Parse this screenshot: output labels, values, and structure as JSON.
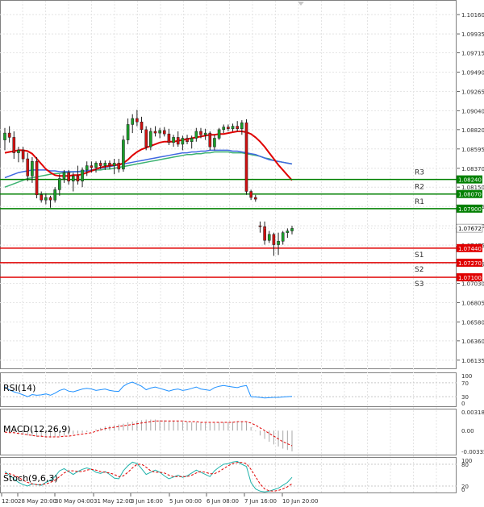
{
  "chart_data": {
    "type": "candlestick",
    "price": {
      "ylim": [
        1.0603,
        1.1033
      ],
      "y_ticks": [
        "1.10160",
        "1.09935",
        "1.09715",
        "1.09490",
        "1.09265",
        "1.09040",
        "1.08820",
        "1.08595",
        "1.08370",
        "1.08150",
        "1.07925",
        "1.07700",
        "1.07475",
        "1.07255",
        "1.07030",
        "1.06805",
        "1.06580",
        "1.06360",
        "1.06135"
      ],
      "levels": [
        {
          "name": "R3",
          "value": 1.0824,
          "label": "1.08240",
          "color": "#008000"
        },
        {
          "name": "R2",
          "value": 1.0807,
          "label": "1.08070",
          "color": "#008000"
        },
        {
          "name": "R1",
          "value": 1.079,
          "label": "1.07900",
          "color": "#008000"
        },
        {
          "name": "S1",
          "value": 1.0744,
          "label": "1.07440",
          "color": "#e00000"
        },
        {
          "name": "S2",
          "value": 1.0727,
          "label": "1.07270",
          "color": "#e00000"
        },
        {
          "name": "S3",
          "value": 1.071,
          "label": "1.07100",
          "color": "#e00000"
        }
      ],
      "current": {
        "value": 1.07672,
        "label": "1.07672"
      },
      "candles": [
        {
          "o": 1.087,
          "h": 1.0884,
          "l": 1.0858,
          "c": 1.0878
        },
        {
          "o": 1.0878,
          "h": 1.0886,
          "l": 1.0867,
          "c": 1.0873
        },
        {
          "o": 1.0873,
          "h": 1.088,
          "l": 1.0848,
          "c": 1.0855
        },
        {
          "o": 1.0855,
          "h": 1.0862,
          "l": 1.0844,
          "c": 1.0858
        },
        {
          "o": 1.0858,
          "h": 1.0862,
          "l": 1.0844,
          "c": 1.0848
        },
        {
          "o": 1.0848,
          "h": 1.0855,
          "l": 1.0822,
          "c": 1.0828
        },
        {
          "o": 1.0828,
          "h": 1.085,
          "l": 1.082,
          "c": 1.0845
        },
        {
          "o": 1.0845,
          "h": 1.085,
          "l": 1.0802,
          "c": 1.0806
        },
        {
          "o": 1.0806,
          "h": 1.081,
          "l": 1.0797,
          "c": 1.08
        },
        {
          "o": 1.08,
          "h": 1.0808,
          "l": 1.0795,
          "c": 1.0803
        },
        {
          "o": 1.0803,
          "h": 1.0805,
          "l": 1.0791,
          "c": 1.08
        },
        {
          "o": 1.08,
          "h": 1.0815,
          "l": 1.0797,
          "c": 1.0812
        },
        {
          "o": 1.0812,
          "h": 1.083,
          "l": 1.0805,
          "c": 1.0825
        },
        {
          "o": 1.0825,
          "h": 1.0835,
          "l": 1.082,
          "c": 1.0832
        },
        {
          "o": 1.0832,
          "h": 1.0835,
          "l": 1.0818,
          "c": 1.0822
        },
        {
          "o": 1.0822,
          "h": 1.0832,
          "l": 1.081,
          "c": 1.0828
        },
        {
          "o": 1.0828,
          "h": 1.084,
          "l": 1.0818,
          "c": 1.0822
        },
        {
          "o": 1.0822,
          "h": 1.0838,
          "l": 1.0815,
          "c": 1.0835
        },
        {
          "o": 1.0835,
          "h": 1.0845,
          "l": 1.0828,
          "c": 1.084
        },
        {
          "o": 1.084,
          "h": 1.0845,
          "l": 1.0832,
          "c": 1.0838
        },
        {
          "o": 1.0838,
          "h": 1.0845,
          "l": 1.0832,
          "c": 1.0843
        },
        {
          "o": 1.0843,
          "h": 1.0846,
          "l": 1.0836,
          "c": 1.084
        },
        {
          "o": 1.084,
          "h": 1.0846,
          "l": 1.0835,
          "c": 1.0843
        },
        {
          "o": 1.0843,
          "h": 1.0846,
          "l": 1.0836,
          "c": 1.084
        },
        {
          "o": 1.084,
          "h": 1.0848,
          "l": 1.083,
          "c": 1.0843
        },
        {
          "o": 1.0843,
          "h": 1.0848,
          "l": 1.0832,
          "c": 1.0836
        },
        {
          "o": 1.0836,
          "h": 1.0875,
          "l": 1.0833,
          "c": 1.087
        },
        {
          "o": 1.087,
          "h": 1.0895,
          "l": 1.0865,
          "c": 1.0888
        },
        {
          "o": 1.0888,
          "h": 1.09,
          "l": 1.0878,
          "c": 1.0895
        },
        {
          "o": 1.0895,
          "h": 1.0905,
          "l": 1.0886,
          "c": 1.0891
        },
        {
          "o": 1.0891,
          "h": 1.0897,
          "l": 1.0878,
          "c": 1.0882
        },
        {
          "o": 1.0882,
          "h": 1.0886,
          "l": 1.0858,
          "c": 1.0862
        },
        {
          "o": 1.0862,
          "h": 1.0884,
          "l": 1.0858,
          "c": 1.088
        },
        {
          "o": 1.088,
          "h": 1.0886,
          "l": 1.0874,
          "c": 1.0878
        },
        {
          "o": 1.0878,
          "h": 1.0884,
          "l": 1.0872,
          "c": 1.0881
        },
        {
          "o": 1.0881,
          "h": 1.0885,
          "l": 1.0874,
          "c": 1.0877
        },
        {
          "o": 1.0877,
          "h": 1.0883,
          "l": 1.0864,
          "c": 1.0867
        },
        {
          "o": 1.0867,
          "h": 1.0876,
          "l": 1.0862,
          "c": 1.0873
        },
        {
          "o": 1.0873,
          "h": 1.088,
          "l": 1.0862,
          "c": 1.0865
        },
        {
          "o": 1.0865,
          "h": 1.0875,
          "l": 1.0858,
          "c": 1.0872
        },
        {
          "o": 1.0872,
          "h": 1.0876,
          "l": 1.0865,
          "c": 1.0868
        },
        {
          "o": 1.0868,
          "h": 1.0875,
          "l": 1.086,
          "c": 1.0872
        },
        {
          "o": 1.0872,
          "h": 1.0884,
          "l": 1.0868,
          "c": 1.088
        },
        {
          "o": 1.088,
          "h": 1.0884,
          "l": 1.0872,
          "c": 1.0876
        },
        {
          "o": 1.0876,
          "h": 1.0883,
          "l": 1.087,
          "c": 1.0878
        },
        {
          "o": 1.0878,
          "h": 1.088,
          "l": 1.0858,
          "c": 1.0862
        },
        {
          "o": 1.0862,
          "h": 1.0876,
          "l": 1.0858,
          "c": 1.0872
        },
        {
          "o": 1.0872,
          "h": 1.0884,
          "l": 1.087,
          "c": 1.0882
        },
        {
          "o": 1.0882,
          "h": 1.0888,
          "l": 1.0878,
          "c": 1.0885
        },
        {
          "o": 1.0885,
          "h": 1.0888,
          "l": 1.088,
          "c": 1.0883
        },
        {
          "o": 1.0883,
          "h": 1.0889,
          "l": 1.088,
          "c": 1.0886
        },
        {
          "o": 1.0886,
          "h": 1.0892,
          "l": 1.088,
          "c": 1.0883
        },
        {
          "o": 1.0883,
          "h": 1.0893,
          "l": 1.0876,
          "c": 1.089
        },
        {
          "o": 1.089,
          "h": 1.0894,
          "l": 1.0806,
          "c": 1.081
        },
        {
          "o": 1.081,
          "h": 1.0812,
          "l": 1.08,
          "c": 1.0803
        },
        {
          "o": 1.0803,
          "h": 1.0806,
          "l": 1.0798,
          "c": 1.0801
        },
        {
          "o": 1.077,
          "h": 1.0775,
          "l": 1.0762,
          "c": 1.0769
        },
        {
          "o": 1.0769,
          "h": 1.0775,
          "l": 1.0748,
          "c": 1.0753
        },
        {
          "o": 1.0753,
          "h": 1.0764,
          "l": 1.075,
          "c": 1.076
        },
        {
          "o": 1.076,
          "h": 1.0762,
          "l": 1.0735,
          "c": 1.0748
        },
        {
          "o": 1.0748,
          "h": 1.0762,
          "l": 1.0736,
          "c": 1.0752
        },
        {
          "o": 1.0752,
          "h": 1.0764,
          "l": 1.0748,
          "c": 1.0762
        },
        {
          "o": 1.0762,
          "h": 1.0767,
          "l": 1.0756,
          "c": 1.0764
        },
        {
          "o": 1.0764,
          "h": 1.077,
          "l": 1.076,
          "c": 1.0767
        }
      ],
      "ma_red": [
        1.0855,
        1.0856,
        1.0857,
        1.0858,
        1.0858,
        1.0857,
        1.0854,
        1.0848,
        1.0842,
        1.0836,
        1.0832,
        1.0829,
        1.0828,
        1.0828,
        1.0828,
        1.0829,
        1.0829,
        1.083,
        1.0832,
        1.0834,
        1.0836,
        1.0838,
        1.0839,
        1.084,
        1.0841,
        1.0841,
        1.0843,
        1.0847,
        1.0852,
        1.0856,
        1.0859,
        1.0861,
        1.0863,
        1.0865,
        1.0867,
        1.0868,
        1.0868,
        1.0868,
        1.0869,
        1.087,
        1.0871,
        1.0872,
        1.0873,
        1.0874,
        1.0875,
        1.0876,
        1.0876,
        1.0877,
        1.0877,
        1.0878,
        1.0879,
        1.088,
        1.088,
        1.0879,
        1.0877,
        1.0873,
        1.0868,
        1.0862,
        1.0855,
        1.0848,
        1.0841,
        1.0835,
        1.0829,
        1.0823
      ],
      "ma_blue": [
        1.0826,
        1.0828,
        1.083,
        1.0832,
        1.0833,
        1.0834,
        1.0835,
        1.0835,
        1.0835,
        1.0835,
        1.0834,
        1.0834,
        1.0833,
        1.0833,
        1.0833,
        1.0833,
        1.0833,
        1.0834,
        1.0834,
        1.0835,
        1.0836,
        1.0837,
        1.0838,
        1.0839,
        1.084,
        1.0841,
        1.0842,
        1.0843,
        1.0844,
        1.0845,
        1.0846,
        1.0847,
        1.0848,
        1.0849,
        1.085,
        1.0851,
        1.0852,
        1.0853,
        1.0854,
        1.0855,
        1.0855,
        1.0856,
        1.0856,
        1.0857,
        1.0857,
        1.0858,
        1.0858,
        1.0858,
        1.0858,
        1.0858,
        1.0857,
        1.0857,
        1.0856,
        1.0855,
        1.0854,
        1.0853,
        1.0851,
        1.0849,
        1.0847,
        1.0846,
        1.0845,
        1.0844,
        1.0843,
        1.0842
      ],
      "ma_green": [
        1.0815,
        1.0817,
        1.0819,
        1.0821,
        1.0823,
        1.0825,
        1.0826,
        1.0827,
        1.0828,
        1.0829,
        1.083,
        1.0831,
        1.0831,
        1.0832,
        1.0832,
        1.0833,
        1.0833,
        1.0833,
        1.0834,
        1.0834,
        1.0835,
        1.0835,
        1.0836,
        1.0836,
        1.0837,
        1.0838,
        1.0839,
        1.084,
        1.0841,
        1.0842,
        1.0843,
        1.0844,
        1.0845,
        1.0846,
        1.0847,
        1.0848,
        1.0849,
        1.085,
        1.0851,
        1.0852,
        1.0853,
        1.0853,
        1.0854,
        1.0854,
        1.0855,
        1.0855,
        1.0856,
        1.0856,
        1.0856,
        1.0856,
        1.0855,
        1.0855,
        1.0855,
        1.0854,
        1.0853,
        1.0852,
        1.0851,
        1.0849,
        1.0848,
        1.0846,
        1.0845,
        1.0844,
        1.0843,
        1.0842
      ]
    },
    "rsi": {
      "label": "RSI(14)",
      "ylim": [
        0,
        100
      ],
      "y_ticks": [
        "100",
        "70",
        "30",
        "0"
      ],
      "values": [
        58,
        50,
        44,
        40,
        35,
        30,
        36,
        34,
        35,
        38,
        34,
        40,
        48,
        52,
        46,
        44,
        48,
        52,
        54,
        52,
        48,
        50,
        52,
        48,
        46,
        45,
        60,
        68,
        72,
        66,
        60,
        50,
        55,
        58,
        54,
        50,
        46,
        50,
        52,
        48,
        50,
        54,
        58,
        52,
        50,
        48,
        56,
        60,
        62,
        60,
        58,
        56,
        60,
        62,
        30,
        29,
        28,
        26,
        27,
        28,
        28,
        29,
        30,
        31
      ]
    },
    "macd": {
      "label": "MACD(12,26,9)",
      "ylim": [
        -0.00359,
        0.00318
      ],
      "y_ticks": [
        "0.003182",
        "0.00",
        "-0.003359"
      ],
      "histogram": [
        -0.0003,
        -0.0003,
        -0.0004,
        -0.0005,
        -0.0006,
        -0.0007,
        -0.0008,
        -0.0009,
        -0.0009,
        -0.001,
        -0.001,
        -0.0009,
        -0.0008,
        -0.0007,
        -0.0006,
        -0.0005,
        -0.0004,
        -0.0003,
        -0.0002,
        0.0,
        0.0002,
        0.0004,
        0.0006,
        0.0007,
        0.0008,
        0.0009,
        0.001,
        0.0012,
        0.0013,
        0.0014,
        0.0015,
        0.0016,
        0.0016,
        0.0016,
        0.0015,
        0.0015,
        0.0014,
        0.0014,
        0.0014,
        0.0013,
        0.0013,
        0.0012,
        0.0012,
        0.0012,
        0.0011,
        0.0011,
        0.0011,
        0.0012,
        0.0012,
        0.0012,
        0.0013,
        0.0013,
        0.0013,
        0.0012,
        0.0005,
        -0.0001,
        -0.0007,
        -0.0012,
        -0.0016,
        -0.002,
        -0.0023,
        -0.0026,
        -0.0028,
        -0.003
      ],
      "signal": [
        -0.0002,
        -0.0003,
        -0.0003,
        -0.0004,
        -0.0005,
        -0.0006,
        -0.0007,
        -0.0008,
        -0.0008,
        -0.0009,
        -0.0009,
        -0.0009,
        -0.0009,
        -0.0008,
        -0.0008,
        -0.0007,
        -0.0006,
        -0.0005,
        -0.0004,
        -0.0003,
        -0.0001,
        0.0001,
        0.0003,
        0.0004,
        0.0005,
        0.0006,
        0.0007,
        0.0008,
        0.0009,
        0.001,
        0.0011,
        0.0012,
        0.0013,
        0.0014,
        0.0014,
        0.0014,
        0.0014,
        0.0014,
        0.0014,
        0.0014,
        0.0013,
        0.0013,
        0.0013,
        0.0012,
        0.0012,
        0.0012,
        0.0012,
        0.0012,
        0.0012,
        0.0012,
        0.0012,
        0.0013,
        0.0013,
        0.0013,
        0.0011,
        0.0008,
        0.0004,
        0.0,
        -0.0004,
        -0.0008,
        -0.0012,
        -0.0016,
        -0.0019,
        -0.0022
      ]
    },
    "stoch": {
      "label": "Stoch(9,6,3)",
      "ylim": [
        0,
        100
      ],
      "y_ticks": [
        "100",
        "80",
        "20",
        "0"
      ],
      "main": [
        60,
        50,
        40,
        30,
        24,
        20,
        26,
        24,
        22,
        30,
        36,
        46,
        62,
        68,
        60,
        52,
        60,
        66,
        70,
        66,
        58,
        55,
        60,
        52,
        42,
        40,
        62,
        76,
        86,
        82,
        68,
        52,
        58,
        64,
        58,
        48,
        40,
        45,
        50,
        44,
        48,
        56,
        64,
        58,
        52,
        46,
        62,
        72,
        80,
        82,
        86,
        88,
        80,
        74,
        30,
        12,
        6,
        4,
        6,
        10,
        14,
        22,
        30,
        44
      ],
      "signal": [
        55,
        54,
        50,
        44,
        36,
        30,
        26,
        24,
        24,
        26,
        30,
        36,
        46,
        56,
        62,
        62,
        60,
        60,
        64,
        66,
        64,
        60,
        58,
        56,
        52,
        46,
        48,
        58,
        70,
        80,
        80,
        72,
        62,
        58,
        58,
        56,
        50,
        46,
        46,
        46,
        46,
        50,
        56,
        60,
        58,
        54,
        54,
        60,
        68,
        76,
        82,
        85,
        85,
        82,
        66,
        46,
        26,
        12,
        7,
        6,
        8,
        12,
        18,
        26
      ]
    },
    "x_ticks": [
      "12:00",
      "28 May 20:00",
      "30 May 04:00",
      "31 May 12:00",
      "3 Jun 16:00",
      "5 Jun 00:00",
      "6 Jun 08:00",
      "7 Jun 16:00",
      "10 Jun 20:00"
    ]
  }
}
